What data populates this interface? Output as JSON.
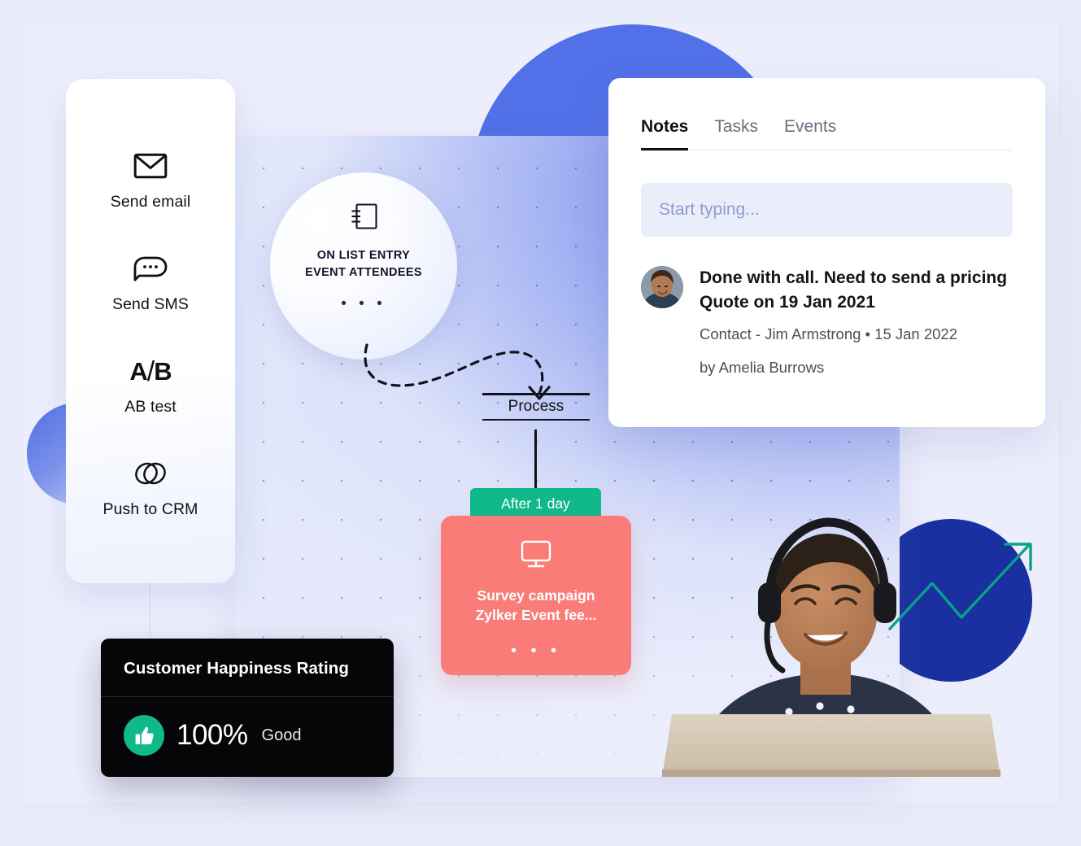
{
  "theme": {
    "page_bg": "#e7eaf8",
    "panel_bg": "#edeefc",
    "accent_blue": "#5271e8",
    "deep_blue": "#1a30a0",
    "violet": "#6a74d4",
    "green": "#0fb98a",
    "coral": "#fa7c78",
    "dark": "#060608",
    "teal_line": "#0aa08a"
  },
  "actions": {
    "items": [
      {
        "icon": "envelope-icon",
        "label": "Send email"
      },
      {
        "icon": "chat-bubble-dots-icon",
        "label": "Send SMS"
      },
      {
        "icon": "ab-split-icon",
        "label": "AB test",
        "glyph_a": "A",
        "glyph_slash": "/",
        "glyph_b": "B"
      },
      {
        "icon": "chain-link-icon",
        "label": "Push to CRM"
      }
    ]
  },
  "workflow": {
    "trigger": {
      "icon": "list-entry-icon",
      "line1": "ON LIST ENTRY",
      "line2": "EVENT ATTENDEES",
      "more": "• • •"
    },
    "process_label": "Process",
    "delay_label": "After 1 day",
    "survey": {
      "icon": "monitor-icon",
      "line1": "Survey campaign",
      "line2": "Zylker Event fee...",
      "more": "• • •"
    }
  },
  "happiness": {
    "title": "Customer Happiness Rating",
    "icon": "thumbs-up-icon",
    "value": "100%",
    "qualifier": "Good"
  },
  "notes": {
    "tabs": [
      {
        "label": "Notes",
        "active": true
      },
      {
        "label": "Tasks",
        "active": false
      },
      {
        "label": "Events",
        "active": false
      }
    ],
    "input_placeholder": "Start typing...",
    "entry": {
      "avatar": "user-avatar",
      "text": "Done with call. Need to send a pricing Quote on 19 Jan 2021",
      "meta_contact": "Contact - Jim Armstrong • 15 Jan 2022",
      "meta_author": "by Amelia Burrows"
    }
  },
  "decor": {
    "chart_arrow": "growth-arrow-icon",
    "person": "support-agent-photo"
  }
}
